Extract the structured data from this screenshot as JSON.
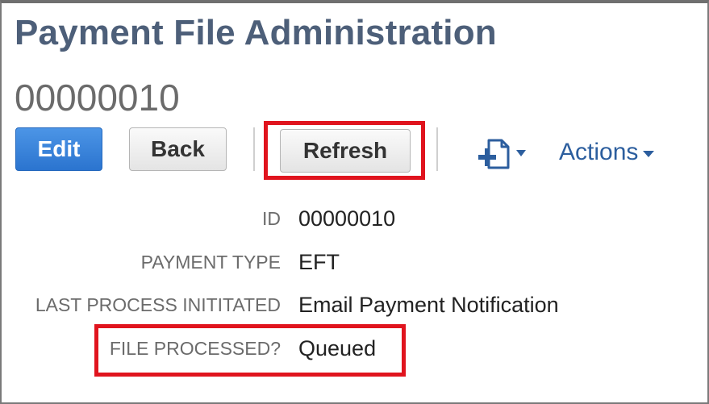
{
  "header": {
    "title": "Payment File Administration",
    "record_id": "00000010"
  },
  "toolbar": {
    "edit_label": "Edit",
    "back_label": "Back",
    "refresh_label": "Refresh",
    "new_document_icon": "new-document-plus-icon",
    "actions_label": "Actions"
  },
  "fields": [
    {
      "label": "ID",
      "value": "00000010"
    },
    {
      "label": "PAYMENT TYPE",
      "value": "EFT"
    },
    {
      "label": "LAST PROCESS INITITATED",
      "value": "Email Payment Notification"
    },
    {
      "label": "FILE PROCESSED?",
      "value": "Queued"
    }
  ],
  "colors": {
    "title": "#4d5f79",
    "primary_button": "#2b74cf",
    "link": "#2c5e9e",
    "highlight": "#e0141e"
  }
}
